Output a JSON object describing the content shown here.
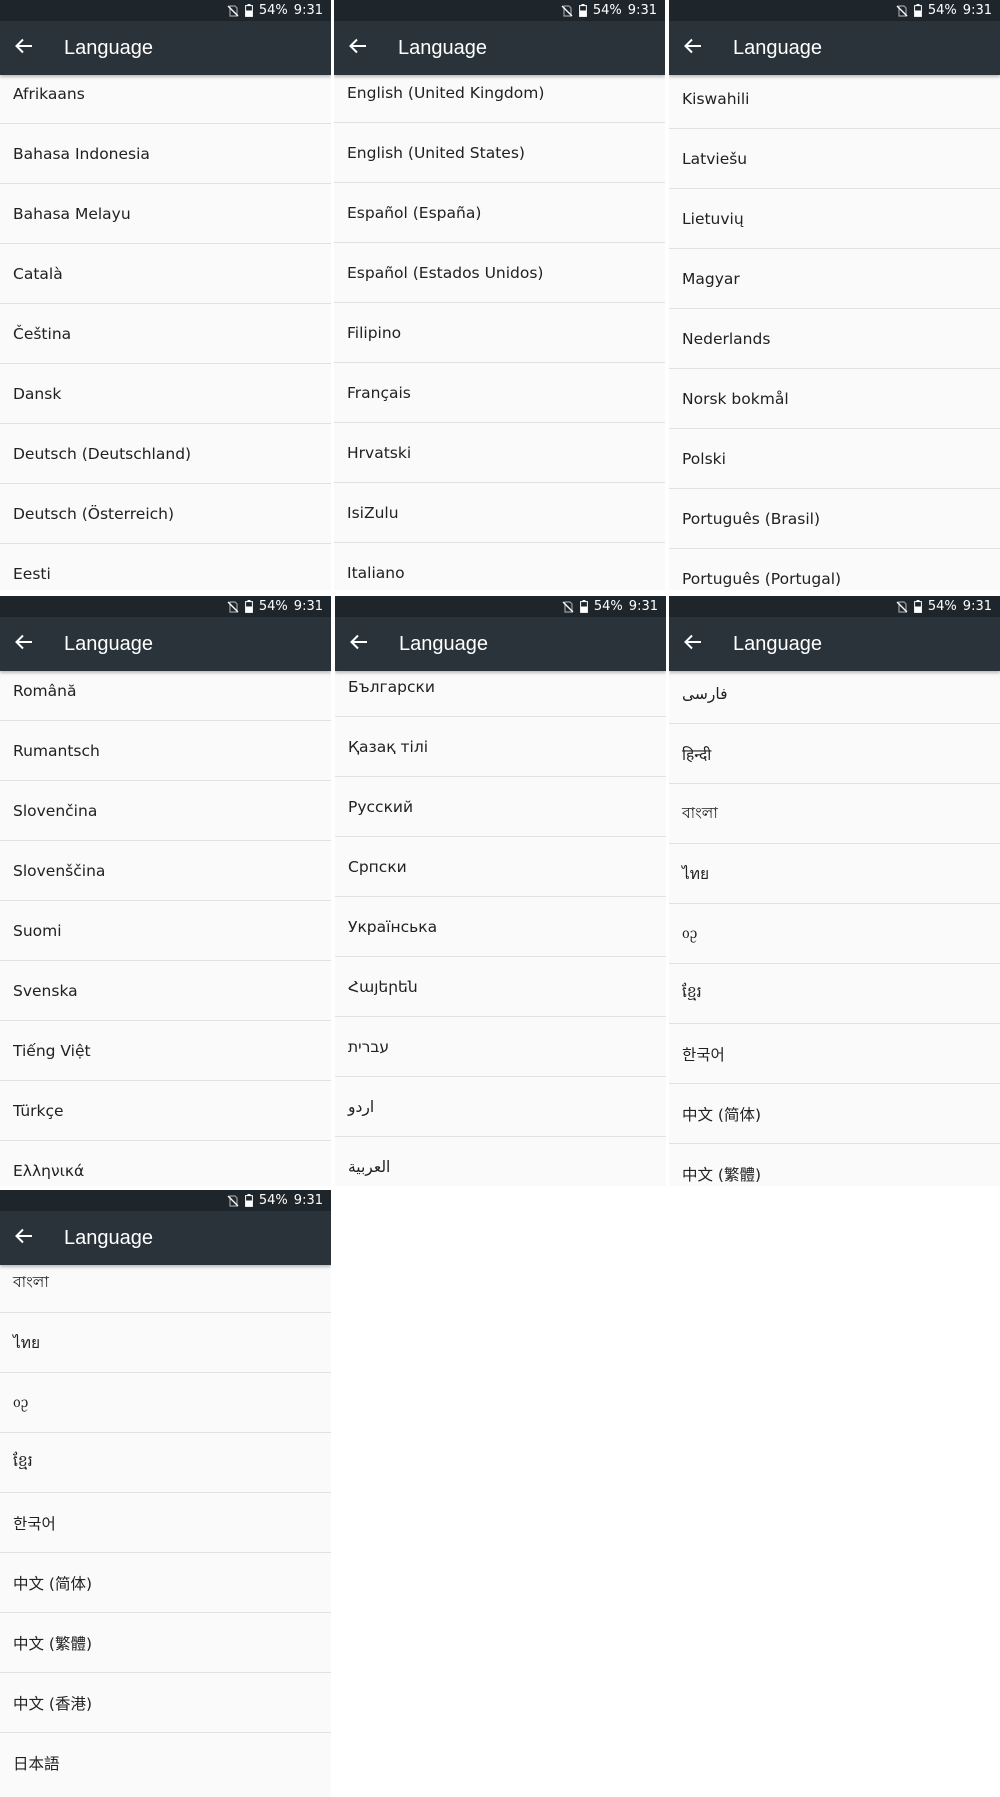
{
  "status": {
    "battery": "54%",
    "time": "9:31"
  },
  "app_bar": {
    "title": "Language"
  },
  "screens": [
    {
      "items": [
        "Afrikaans",
        "Bahasa Indonesia",
        "Bahasa Melayu",
        "Català",
        "Čeština",
        "Dansk",
        "Deutsch (Deutschland)",
        "Deutsch (Österreich)",
        "Eesti"
      ]
    },
    {
      "items": [
        "English (United Kingdom)",
        "English (United States)",
        "Español (España)",
        "Español (Estados Unidos)",
        "Filipino",
        "Français",
        "Hrvatski",
        "IsiZulu",
        "Italiano"
      ]
    },
    {
      "items": [
        "Kiswahili",
        "Latviešu",
        "Lietuvių",
        "Magyar",
        "Nederlands",
        "Norsk bokmål",
        "Polski",
        "Português (Brasil)",
        "Português (Portugal)"
      ]
    },
    {
      "items": [
        "Română",
        "Rumantsch",
        "Slovenčina",
        "Slovenščina",
        "Suomi",
        "Svenska",
        "Tiếng Việt",
        "Türkçe",
        "Ελληνικά"
      ]
    },
    {
      "items": [
        "Български",
        "Қазақ тілі",
        "Русский",
        "Српски",
        "Українська",
        "Հայերեն",
        "עברית",
        "اردو",
        "العربية"
      ]
    },
    {
      "items": [
        "فارسی",
        "हिन्दी",
        "বাংলা",
        "ไทย",
        "ᦞᦳ",
        "ខ្មែរ",
        "한국어",
        "中文 (简体)",
        "中文 (繁體)"
      ]
    },
    {
      "items": [
        "বাংলা",
        "ไทย",
        "ᦞᦳ",
        "ខ្មែរ",
        "한국어",
        "中文 (简体)",
        "中文 (繁體)",
        "中文 (香港)",
        "日本語"
      ]
    }
  ]
}
